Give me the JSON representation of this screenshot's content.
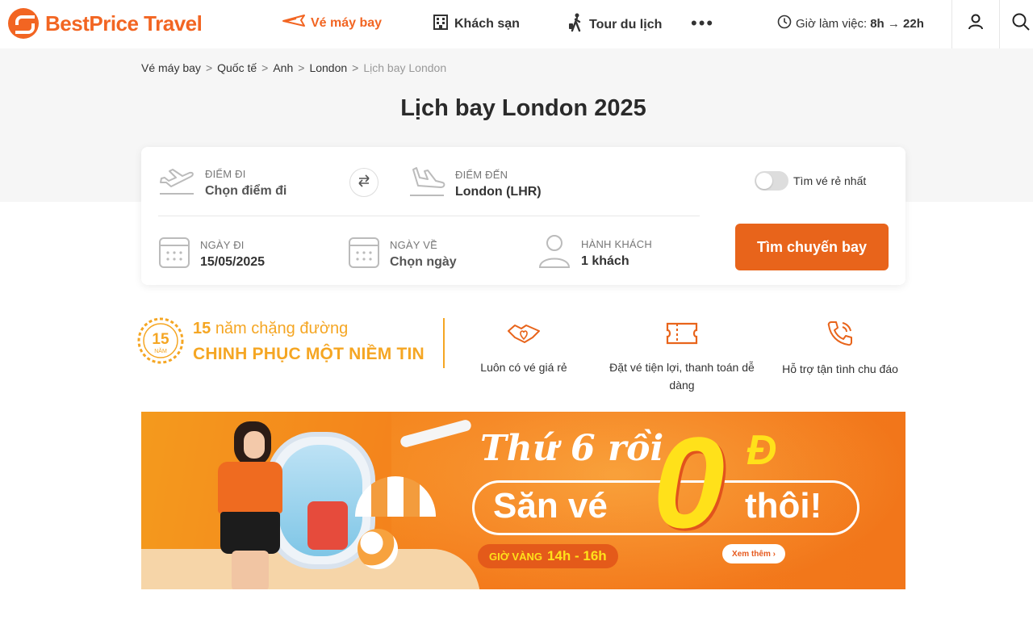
{
  "brand": {
    "name": "BestPrice Travel",
    "color": "#f26522"
  },
  "nav": {
    "flights": "Vé máy bay",
    "hotels": "Khách sạn",
    "tours": "Tour du lịch",
    "more": "•••"
  },
  "hours": {
    "label": "Giờ làm việc:",
    "value": "8h → 22h"
  },
  "header_icons": [
    "user-icon",
    "search-icon"
  ],
  "breadcrumb": {
    "items": [
      "Vé máy bay",
      "Quốc tế",
      "Anh",
      "London"
    ],
    "current": "Lịch bay London",
    "separator": ">"
  },
  "page_title": "Lịch bay London 2025",
  "search": {
    "from": {
      "label": "ĐIỂM ĐI",
      "value": "Chọn điểm đi"
    },
    "to": {
      "label": "ĐIỂM ĐẾN",
      "value": "London (LHR)"
    },
    "cheapest_toggle": {
      "label": "Tìm vé rẻ nhất",
      "on": false
    },
    "depart": {
      "label": "NGÀY ĐI",
      "value": "15/05/2025"
    },
    "return": {
      "label": "NGÀY VỀ",
      "value": "Chọn ngày"
    },
    "passengers": {
      "label": "HÀNH KHÁCH",
      "value": "1 khách"
    },
    "submit": "Tìm chuyến bay"
  },
  "promise": {
    "badge_number": "15",
    "badge_word": "NĂM",
    "years_number": "15",
    "line1": "năm chặng đường",
    "line2": "CHINH PHỤC MỘT NIỀM TIN"
  },
  "features": [
    {
      "icon": "handshake-heart-icon",
      "text": "Luôn có vé giá rẻ"
    },
    {
      "icon": "ticket-icon",
      "text": "Đặt vé tiện lợi, thanh toán dễ dàng"
    },
    {
      "icon": "phone-icon",
      "text": "Hỗ trợ tận tình chu đáo"
    }
  ],
  "banner": {
    "headline1": "Thứ 6 rồi",
    "headline2": "Săn vé",
    "zero": "0",
    "currency": "Đ",
    "headline3": "thôi!",
    "golden_label": "GIỜ VÀNG",
    "golden_hours": "14h - 16h",
    "more": "Xem thêm ›"
  }
}
